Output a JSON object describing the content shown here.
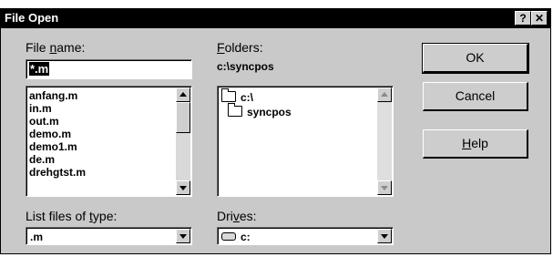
{
  "window": {
    "title": "File Open",
    "help_glyph": "?",
    "close_glyph": "✕"
  },
  "file_name": {
    "label_pre": "File ",
    "label_u": "n",
    "label_post": "ame:",
    "value": "*.m"
  },
  "files": [
    "anfang.m",
    "in.m",
    "out.m",
    "demo.m",
    "demo1.m",
    "de.m",
    "drehgtst.m"
  ],
  "folders": {
    "label_u": "F",
    "label_post": "olders:",
    "path": "c:\\syncpos",
    "items": [
      "c:\\",
      "syncpos"
    ]
  },
  "file_type": {
    "label_pre": "List files of ",
    "label_u": "t",
    "label_post": "ype:",
    "value": ".m"
  },
  "drives": {
    "label_pre": "Dri",
    "label_u": "v",
    "label_post": "es:",
    "value": "c:"
  },
  "buttons": {
    "ok": "OK",
    "cancel": "Cancel",
    "help_u": "H",
    "help_post": "elp"
  }
}
